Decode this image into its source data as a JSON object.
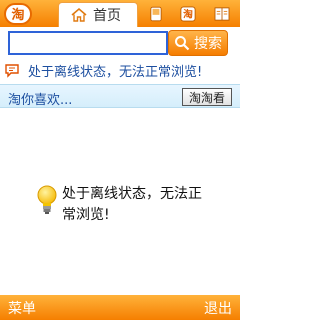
{
  "tabs": {
    "logo_text": "淘",
    "home_label": "首页"
  },
  "search": {
    "placeholder": "",
    "value": "",
    "button_label": "搜索"
  },
  "notice": {
    "top_text": "处于离线状态，无法正常浏览!",
    "main_text": "处于离线状态，无法正常浏览!"
  },
  "recommend": {
    "title": "淘你喜欢...",
    "button_label": "淘淘看"
  },
  "softkeys": {
    "left": "菜单",
    "right": "退出"
  },
  "colors": {
    "accent": "#f57f00",
    "link": "#1d4fa0"
  }
}
